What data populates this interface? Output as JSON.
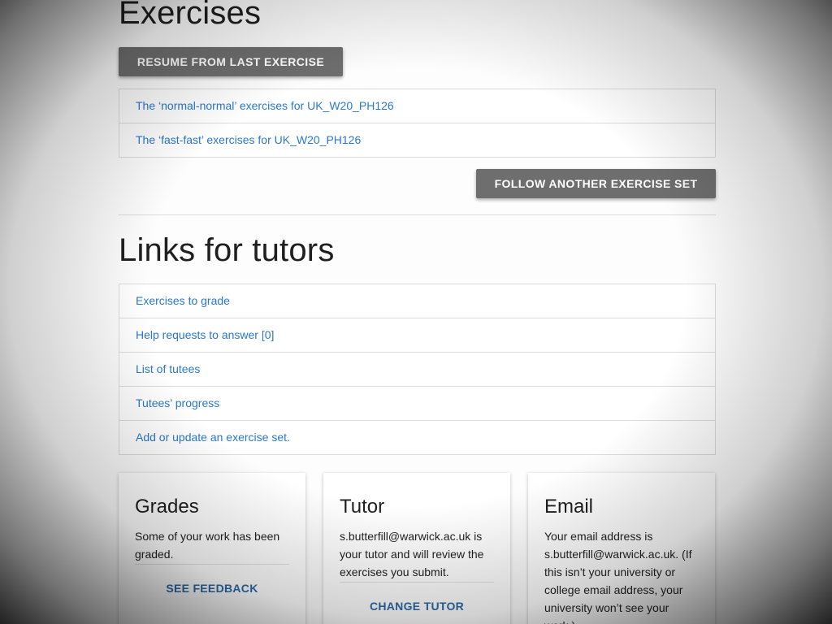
{
  "exercises": {
    "title": "Exercises",
    "resume_button": "Resume from last exercise",
    "items": [
      {
        "label": "The ‘normal-normal’ exercises for UK_W20_PH126"
      },
      {
        "label": "The ‘fast-fast’ exercises for UK_W20_PH126"
      }
    ],
    "follow_button": "Follow another exercise set"
  },
  "tutors": {
    "title": "Links for tutors",
    "items": [
      {
        "label": "Exercises to grade"
      },
      {
        "label": "Help requests to answer [0]"
      },
      {
        "label": "List of tutees"
      },
      {
        "label": "Tutees’ progress"
      },
      {
        "label": "Add or update an exercise set."
      }
    ]
  },
  "cards": {
    "grades": {
      "title": "Grades",
      "text": "Some of your work has been graded.",
      "action": "See feedback"
    },
    "tutor": {
      "title": "Tutor",
      "text": "s.butterfill@warwick.ac.uk is your tutor and will review the exercises you submit.",
      "action": "Change tutor"
    },
    "email": {
      "title": "Email",
      "text": "Your email address is s.butterfill@warwick.ac.uk. (If this isn’t your university or college email address, your university won’t see your work.)"
    }
  },
  "colors": {
    "link": "#2a79c9",
    "button_bg": "#6e6e6e",
    "card_action": "#2b6aa8"
  }
}
